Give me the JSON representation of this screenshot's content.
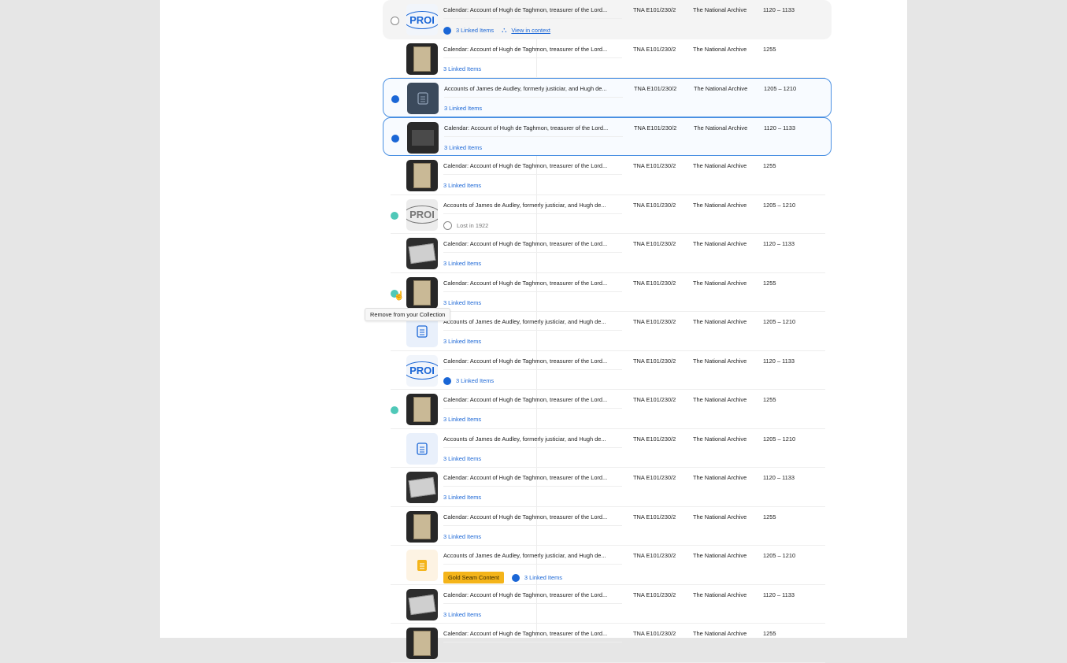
{
  "tooltip": "Remove from your Collection",
  "rows": [
    {
      "title": "Calendar: Account of Hugh de Taghmon, treasurer of the Lord...",
      "ref": "TNA E101/230/2",
      "archive": "The National Archive",
      "date": "1120 – 1133",
      "linked": "3 Linked Items",
      "context": "View in context",
      "thumb": "proi"
    },
    {
      "title": "Calendar: Account of Hugh de Taghmon, treasurer of the Lord...",
      "ref": "TNA E101/230/2",
      "archive": "The National Archive",
      "date": "1255",
      "linked": "3 Linked Items",
      "thumb": "photo"
    },
    {
      "title": "Accounts of James de Audley, formerly justiciar, and Hugh de...",
      "ref": "TNA E101/230/2",
      "archive": "The National Archive",
      "date": "1205 – 1210",
      "linked": "3 Linked Items",
      "thumb": "grayicon"
    },
    {
      "title": "Calendar: Account of Hugh de Taghmon, treasurer of the Lord...",
      "ref": "TNA E101/230/2",
      "archive": "The National Archive",
      "date": "1120 – 1133",
      "linked": "3 Linked Items",
      "thumb": "dark"
    },
    {
      "title": "Calendar: Account of Hugh de Taghmon, treasurer of the Lord...",
      "ref": "TNA E101/230/2",
      "archive": "The National Archive",
      "date": "1255",
      "linked": "3 Linked Items",
      "thumb": "photo"
    },
    {
      "title": "Accounts of James de Audley, formerly justiciar, and Hugh de...",
      "ref": "TNA E101/230/2",
      "archive": "The National Archive",
      "date": "1205 – 1210",
      "lost": "Lost in 1922",
      "thumb": "proi-gray"
    },
    {
      "title": "Calendar: Account of Hugh de Taghmon, treasurer of the Lord...",
      "ref": "TNA E101/230/2",
      "archive": "The National Archive",
      "date": "1120 – 1133",
      "linked": "3 Linked Items",
      "thumb": "photo2"
    },
    {
      "title": "Calendar: Account of Hugh de Taghmon, treasurer of the Lord...",
      "ref": "TNA E101/230/2",
      "archive": "The National Archive",
      "date": "1255",
      "linked": "3 Linked Items",
      "thumb": "photo"
    },
    {
      "title": "Accounts of James de Audley, formerly justiciar, and Hugh de...",
      "ref": "TNA E101/230/2",
      "archive": "The National Archive",
      "date": "1205 – 1210",
      "linked": "3 Linked Items",
      "thumb": "docblue"
    },
    {
      "title": "Calendar: Account of Hugh de Taghmon, treasurer of the Lord...",
      "ref": "TNA E101/230/2",
      "archive": "The National Archive",
      "date": "1120 – 1133",
      "linked": "3 Linked Items",
      "thumb": "proi"
    },
    {
      "title": "Calendar: Account of Hugh de Taghmon, treasurer of the Lord...",
      "ref": "TNA E101/230/2",
      "archive": "The National Archive",
      "date": "1255",
      "linked": "3 Linked Items",
      "thumb": "photo"
    },
    {
      "title": "Accounts of James de Audley, formerly justiciar, and Hugh de...",
      "ref": "TNA E101/230/2",
      "archive": "The National Archive",
      "date": "1205 – 1210",
      "linked": "3 Linked Items",
      "thumb": "docblue"
    },
    {
      "title": "Calendar: Account of Hugh de Taghmon, treasurer of the Lord...",
      "ref": "TNA E101/230/2",
      "archive": "The National Archive",
      "date": "1120 – 1133",
      "linked": "3 Linked Items",
      "thumb": "photo2"
    },
    {
      "title": "Calendar: Account of Hugh de Taghmon, treasurer of the Lord...",
      "ref": "TNA E101/230/2",
      "archive": "The National Archive",
      "date": "1255",
      "linked": "3 Linked Items",
      "thumb": "photo"
    },
    {
      "title": "Accounts of James de Audley, formerly justiciar, and Hugh de...",
      "ref": "TNA E101/230/2",
      "archive": "The National Archive",
      "date": "1205 – 1210",
      "gold": "Gold Seam Content",
      "linked": "3 Linked Items",
      "thumb": "docgold"
    },
    {
      "title": "Calendar: Account of Hugh de Taghmon, treasurer of the Lord...",
      "ref": "TNA E101/230/2",
      "archive": "The National Archive",
      "date": "1120 – 1133",
      "linked": "3 Linked Items",
      "thumb": "photo2"
    },
    {
      "title": "Calendar: Account of Hugh de Taghmon, treasurer of the Lord...",
      "ref": "TNA E101/230/2",
      "archive": "The National Archive",
      "date": "1255",
      "thumb": "photo"
    }
  ],
  "proi_label": "PROI"
}
